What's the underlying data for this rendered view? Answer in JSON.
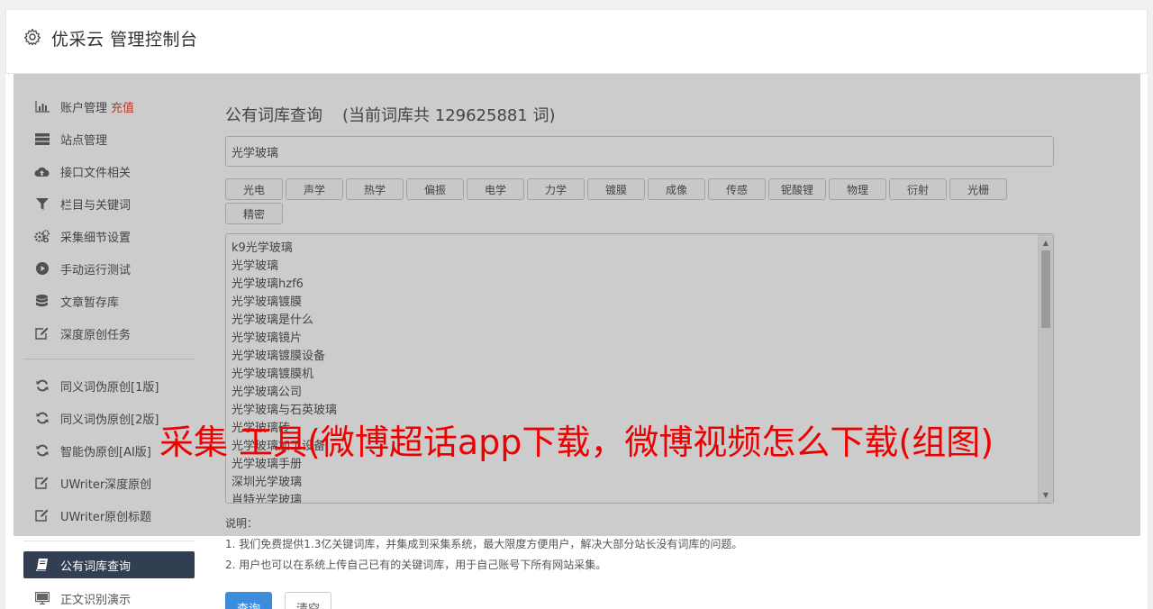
{
  "header": {
    "title": "优采云 管理控制台"
  },
  "sidebar": {
    "items": [
      {
        "label": "账户管理",
        "badge": "充值",
        "icon": "bar-chart-icon"
      },
      {
        "label": "站点管理",
        "icon": "server-icon"
      },
      {
        "label": "接口文件相关",
        "icon": "cloud-upload-icon"
      },
      {
        "label": "栏目与关键词",
        "icon": "filter-icon"
      },
      {
        "label": "采集细节设置",
        "icon": "gears-icon"
      },
      {
        "label": "手动运行测试",
        "icon": "play-circle-icon"
      },
      {
        "label": "文章暂存库",
        "icon": "database-icon"
      },
      {
        "label": "深度原创任务",
        "icon": "edit-icon"
      }
    ],
    "items2": [
      {
        "label": "同义词伪原创[1版]",
        "icon": "refresh-icon"
      },
      {
        "label": "同义词伪原创[2版]",
        "icon": "refresh-icon"
      },
      {
        "label": "智能伪原创[AI版]",
        "icon": "refresh-icon"
      },
      {
        "label": "UWriter深度原创",
        "icon": "edit-icon"
      },
      {
        "label": "UWriter原创标题",
        "icon": "edit-icon"
      }
    ],
    "items3": [
      {
        "label": "公有词库查询",
        "icon": "book-icon"
      },
      {
        "label": "正文识别演示",
        "icon": "monitor-icon"
      }
    ]
  },
  "main": {
    "title": "公有词库查询",
    "count": "(当前词库共 129625881 词)",
    "search_value": "光学玻璃",
    "tags": [
      "光电",
      "声学",
      "热学",
      "偏振",
      "电学",
      "力学",
      "镀膜",
      "成像",
      "传感",
      "铌酸锂",
      "物理",
      "衍射",
      "光栅",
      "精密"
    ],
    "results": [
      "k9光学玻璃",
      "光学玻璃",
      "光学玻璃hzf6",
      "光学玻璃镀膜",
      "光学玻璃是什么",
      "光学玻璃镜片",
      "光学玻璃镀膜设备",
      "光学玻璃镀膜机",
      "光学玻璃公司",
      "光学玻璃与石英玻璃",
      "光学玻璃砖",
      "光学玻璃加工设备",
      "光学玻璃手册",
      "深圳光学玻璃",
      "肖特光学玻璃"
    ],
    "notes_title": "说明：",
    "notes": [
      "1. 我们免费提供1.3亿关键词库，并集成到采集系统，最大限度方便用户，解决大部分站长没有词库的问题。",
      "2. 用户也可以在系统上传自己已有的关键词库，用于自己账号下所有网站采集。"
    ],
    "query_label": "查询",
    "clear_label": "清空"
  },
  "watermark": "采集 工具(微博超话app下载，微博视频怎么下载(组图)"
}
